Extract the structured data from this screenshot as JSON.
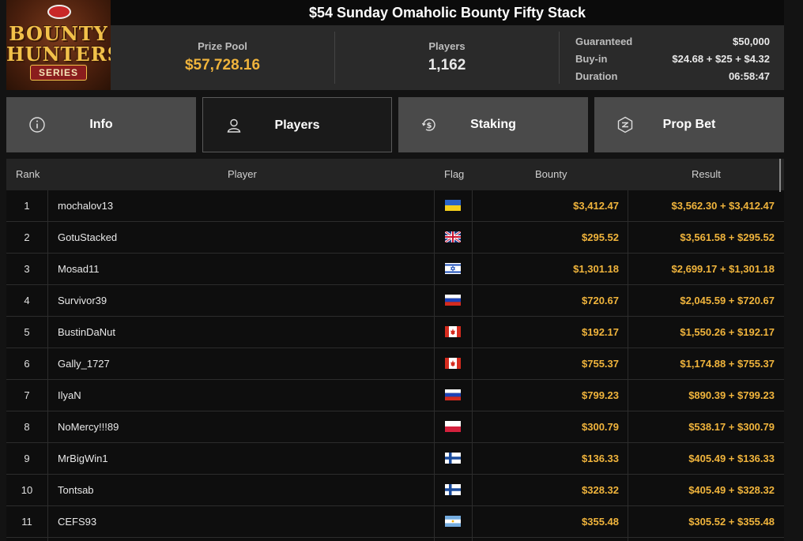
{
  "logo": {
    "line1": "BOUNTY",
    "line2": "HUNTERS",
    "line3": "SERIES"
  },
  "tournament": {
    "title": "$54 Sunday Omaholic Bounty Fifty Stack"
  },
  "stats": {
    "prize_pool_label": "Prize Pool",
    "prize_pool_value": "$57,728.16",
    "players_label": "Players",
    "players_value": "1,162",
    "guaranteed_label": "Guaranteed",
    "guaranteed_value": "$50,000",
    "buyin_label": "Buy-in",
    "buyin_value": "$24.68 + $25 + $4.32",
    "duration_label": "Duration",
    "duration_value": "06:58:47"
  },
  "tabs": [
    {
      "label": "Info",
      "icon": "info-icon",
      "active": false
    },
    {
      "label": "Players",
      "icon": "user-icon",
      "active": true
    },
    {
      "label": "Staking",
      "icon": "dollar-refresh-icon",
      "active": false
    },
    {
      "label": "Prop Bet",
      "icon": "prop-bet-icon",
      "active": false
    }
  ],
  "table": {
    "headers": {
      "rank": "Rank",
      "player": "Player",
      "flag": "Flag",
      "bounty": "Bounty",
      "result": "Result"
    },
    "rows": [
      {
        "rank": "1",
        "player": "mochalov13",
        "flag": "ukraine",
        "bounty": "$3,412.47",
        "result": "$3,562.30 + $3,412.47"
      },
      {
        "rank": "2",
        "player": "GotuStacked",
        "flag": "uk",
        "bounty": "$295.52",
        "result": "$3,561.58 + $295.52"
      },
      {
        "rank": "3",
        "player": "Mosad11",
        "flag": "israel",
        "bounty": "$1,301.18",
        "result": "$2,699.17 + $1,301.18"
      },
      {
        "rank": "4",
        "player": "Survivor39",
        "flag": "russia",
        "bounty": "$720.67",
        "result": "$2,045.59 + $720.67"
      },
      {
        "rank": "5",
        "player": "BustinDaNut",
        "flag": "canada",
        "bounty": "$192.17",
        "result": "$1,550.26 + $192.17"
      },
      {
        "rank": "6",
        "player": "Gally_1727",
        "flag": "canada",
        "bounty": "$755.37",
        "result": "$1,174.88 + $755.37"
      },
      {
        "rank": "7",
        "player": "IlyaN",
        "flag": "russia",
        "bounty": "$799.23",
        "result": "$890.39 + $799.23"
      },
      {
        "rank": "8",
        "player": "NoMercy!!!89",
        "flag": "poland",
        "bounty": "$300.79",
        "result": "$538.17 + $300.79"
      },
      {
        "rank": "9",
        "player": "MrBigWin1",
        "flag": "finland",
        "bounty": "$136.33",
        "result": "$405.49 + $136.33"
      },
      {
        "rank": "10",
        "player": "Tontsab",
        "flag": "finland",
        "bounty": "$328.32",
        "result": "$405.49 + $328.32"
      },
      {
        "rank": "11",
        "player": "CEFS93",
        "flag": "argentina",
        "bounty": "$355.48",
        "result": "$305.52 + $355.48"
      }
    ]
  },
  "colors": {
    "accent": "#f0b43c",
    "tab_inactive": "#4a4a4a",
    "tab_active": "#1a1a1a",
    "header_bg": "#242424"
  }
}
